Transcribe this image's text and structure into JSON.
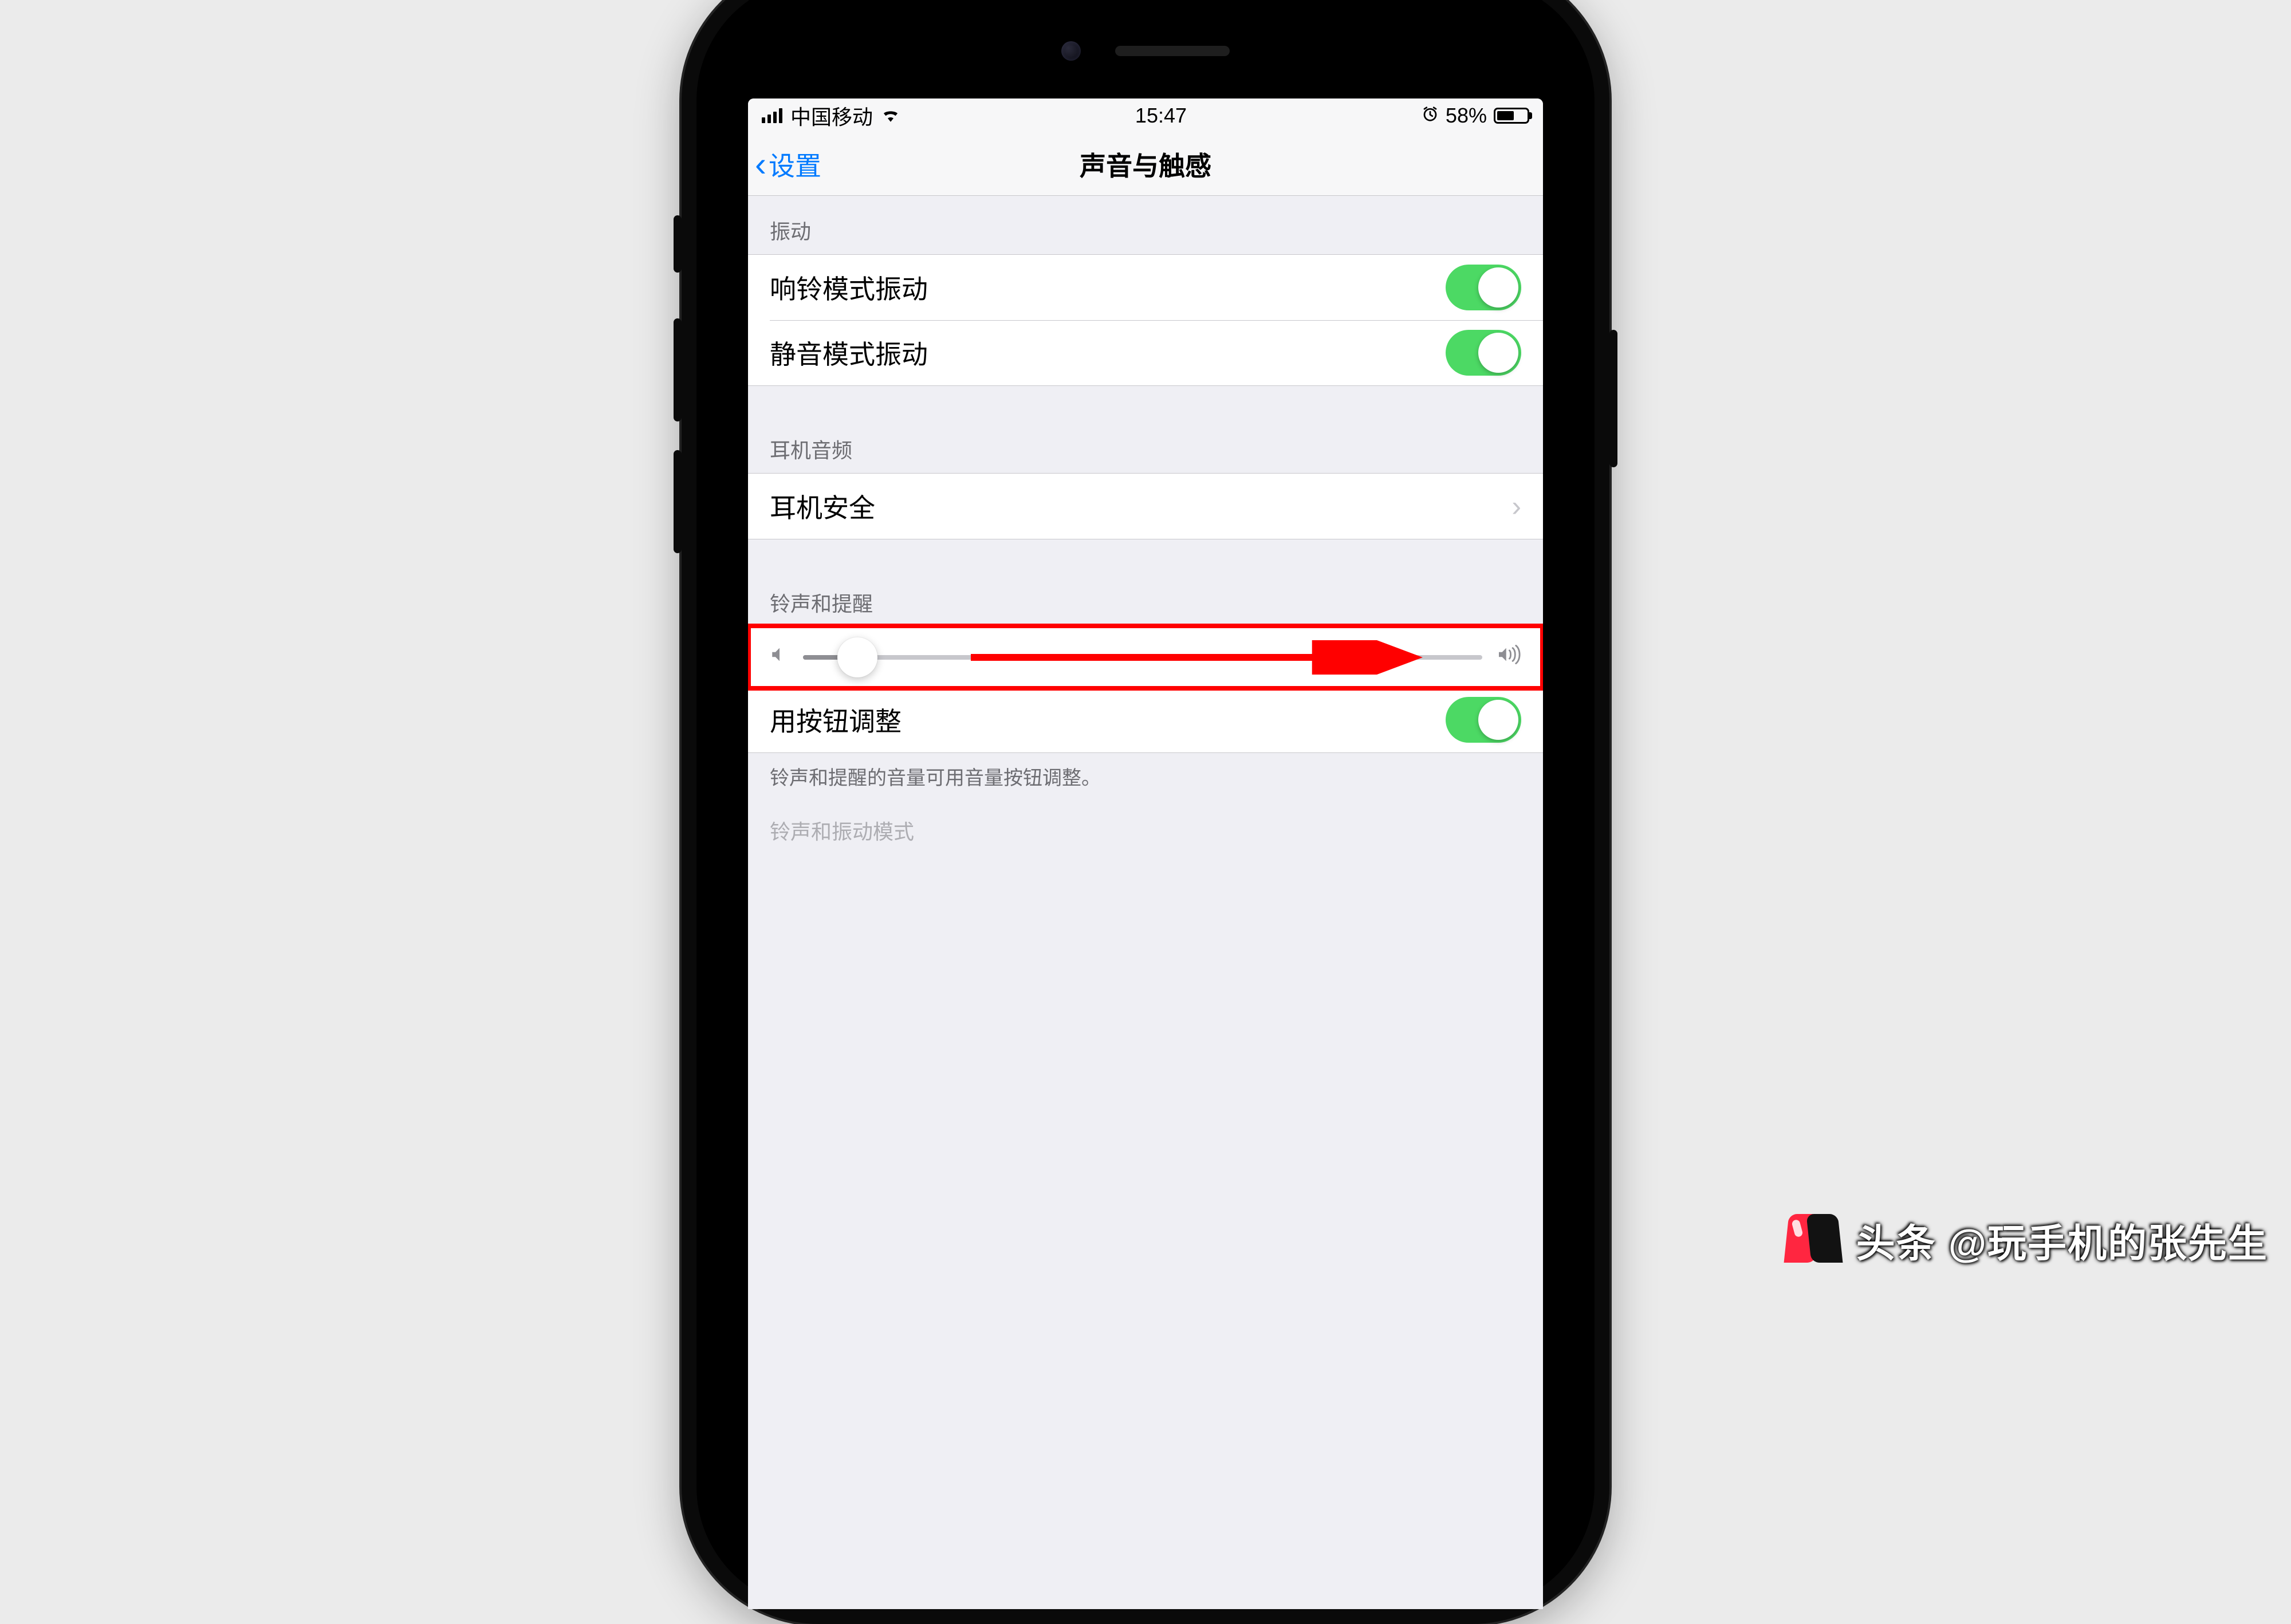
{
  "status_bar": {
    "carrier": "中国移动",
    "time": "15:47",
    "battery_percent": "58%",
    "alarm_icon": "⏰"
  },
  "nav": {
    "back_label": "设置",
    "title": "声音与触感"
  },
  "sections": {
    "vibrate": {
      "header": "振动",
      "ring_vibrate": "响铃模式振动",
      "silent_vibrate": "静音模式振动"
    },
    "headphone": {
      "header": "耳机音频",
      "safety": "耳机安全"
    },
    "ringer": {
      "header": "铃声和提醒",
      "button_adjust": "用按钮调整",
      "footer": "铃声和提醒的音量可用音量按钮调整。"
    },
    "next_header": "铃声和振动模式"
  },
  "toggles": {
    "ring_vibrate_on": true,
    "silent_vibrate_on": true,
    "button_adjust_on": true
  },
  "slider": {
    "value_percent": 10
  },
  "watermark": {
    "text": "头条 @玩手机的张先生"
  }
}
